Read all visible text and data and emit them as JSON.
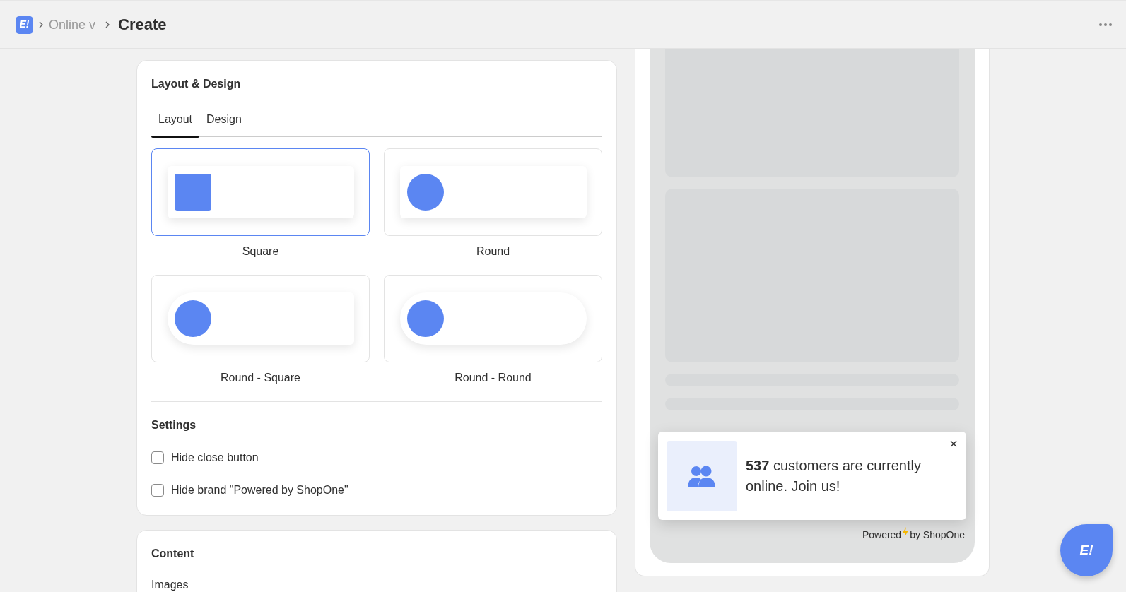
{
  "header": {
    "logo": "E!",
    "breadcrumbs": [
      "Online v"
    ],
    "title": "Create"
  },
  "layout_design": {
    "title": "Layout & Design",
    "tabs": [
      {
        "label": "Layout",
        "selected": true
      },
      {
        "label": "Design",
        "selected": false
      }
    ],
    "options": [
      {
        "kind": "square",
        "label": "Square",
        "selected": true
      },
      {
        "kind": "round",
        "label": "Round",
        "selected": false
      },
      {
        "kind": "round-square",
        "label": "Round - Square",
        "selected": false
      },
      {
        "kind": "round-round",
        "label": "Round - Round",
        "selected": false
      }
    ],
    "settings_title": "Settings",
    "settings": [
      {
        "label": "Hide close button",
        "checked": false
      },
      {
        "label": "Hide brand \"Powered by ShopOne\"",
        "checked": false
      }
    ]
  },
  "content": {
    "title": "Content",
    "images_label": "Images"
  },
  "preview": {
    "close": "×",
    "message": "**537** customers are currently online. Join us!",
    "powered": "Powered",
    "by": "by ShopOne"
  },
  "chat_button": {
    "logo": "E!"
  }
}
